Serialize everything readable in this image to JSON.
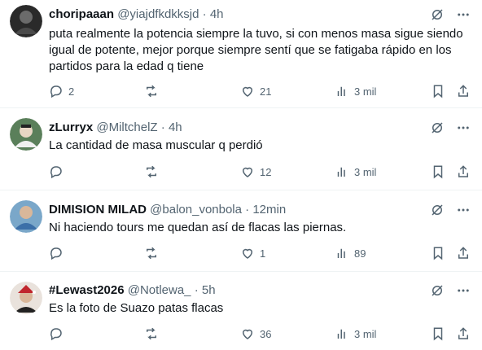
{
  "tweets": [
    {
      "name": "choripaaan",
      "handle": "@yiajdfkdkksjd",
      "dot": "·",
      "time": "4h",
      "text": "puta realmente la potencia siempre la tuvo, si con menos masa sigue siendo igual de potente, mejor porque siempre sentí que se fatigaba rápido en los partidos para la edad q tiene",
      "replies": "2",
      "retweets": "",
      "likes": "21",
      "views": "3 mil"
    },
    {
      "name": "zLurryx",
      "handle": "@MiltchelZ",
      "dot": "·",
      "time": "4h",
      "text": "La cantidad de masa muscular q perdió",
      "replies": "",
      "retweets": "",
      "likes": "12",
      "views": "3 mil"
    },
    {
      "name": "DIMISION MILAD",
      "handle": "@balon_vonbola",
      "dot": "·",
      "time": "12min",
      "text": "Ni haciendo tours me quedan así de flacas las piernas.",
      "replies": "",
      "retweets": "",
      "likes": "1",
      "views": "89"
    },
    {
      "name": "#Lewast2026",
      "handle": "@Notlewa_",
      "dot": "·",
      "time": "5h",
      "text": "Es la foto de Suazo patas flacas",
      "replies": "",
      "retweets": "",
      "likes": "36",
      "views": "3 mil"
    }
  ],
  "icons": {
    "grok": "grok-icon",
    "more": "more-icon",
    "reply": "reply-icon",
    "retweet": "retweet-icon",
    "like": "like-icon",
    "views": "views-icon",
    "bookmark": "bookmark-icon",
    "share": "share-icon"
  },
  "colors": {
    "text": "#0f1419",
    "secondary": "#536471",
    "divider": "#eff3f4"
  }
}
